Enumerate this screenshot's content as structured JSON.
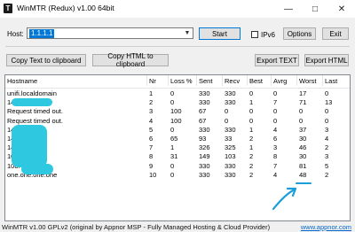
{
  "window": {
    "title": "WinMTR (Redux) v1.00 64bit",
    "icon_letter": "T"
  },
  "host": {
    "label": "Host:",
    "value": "1.1.1.1"
  },
  "buttons": {
    "start": "Start",
    "options": "Options",
    "exit": "Exit",
    "copy_text": "Copy Text to clipboard",
    "copy_html": "Copy HTML to clipboard",
    "export_text": "Export TEXT",
    "export_html": "Export HTML"
  },
  "ipv6": {
    "label": "IPv6",
    "checked": false
  },
  "table": {
    "columns": [
      "Hostname",
      "Nr",
      "Loss %",
      "Sent",
      "Recv",
      "Best",
      "Avrg",
      "Worst",
      "Last"
    ],
    "rows": [
      [
        "unifi.localdomain",
        "1",
        "0",
        "330",
        "330",
        "0",
        "0",
        "17",
        "0"
      ],
      [
        "14",
        "2",
        "0",
        "330",
        "330",
        "1",
        "7",
        "71",
        "13"
      ],
      [
        "Request timed out.",
        "3",
        "100",
        "67",
        "0",
        "0",
        "0",
        "0",
        "0"
      ],
      [
        "Request timed out.",
        "4",
        "100",
        "67",
        "0",
        "0",
        "0",
        "0",
        "0"
      ],
      [
        "14",
        "5",
        "0",
        "330",
        "330",
        "1",
        "4",
        "37",
        "3"
      ],
      [
        "142.",
        "6",
        "65",
        "93",
        "33",
        "2",
        "6",
        "30",
        "4"
      ],
      [
        "142.",
        "7",
        "1",
        "326",
        "325",
        "1",
        "3",
        "46",
        "2"
      ],
      [
        "108.",
        "8",
        "31",
        "149",
        "103",
        "2",
        "8",
        "30",
        "3"
      ],
      [
        "108.",
        "9",
        "0",
        "330",
        "330",
        "2",
        "7",
        "81",
        "5"
      ],
      [
        "one.one.one.one",
        "10",
        "0",
        "330",
        "330",
        "2",
        "4",
        "48",
        "2"
      ]
    ]
  },
  "status": {
    "text": "WinMTR v1.00 GPLv2 (original by Appnor MSP - Fully Managed Hosting & Cloud Provider)",
    "link": "www.appnor.com"
  },
  "colors": {
    "accent": "#0078d7",
    "redaction": "#2ec8e0",
    "annotation": "#1a9fd8"
  }
}
